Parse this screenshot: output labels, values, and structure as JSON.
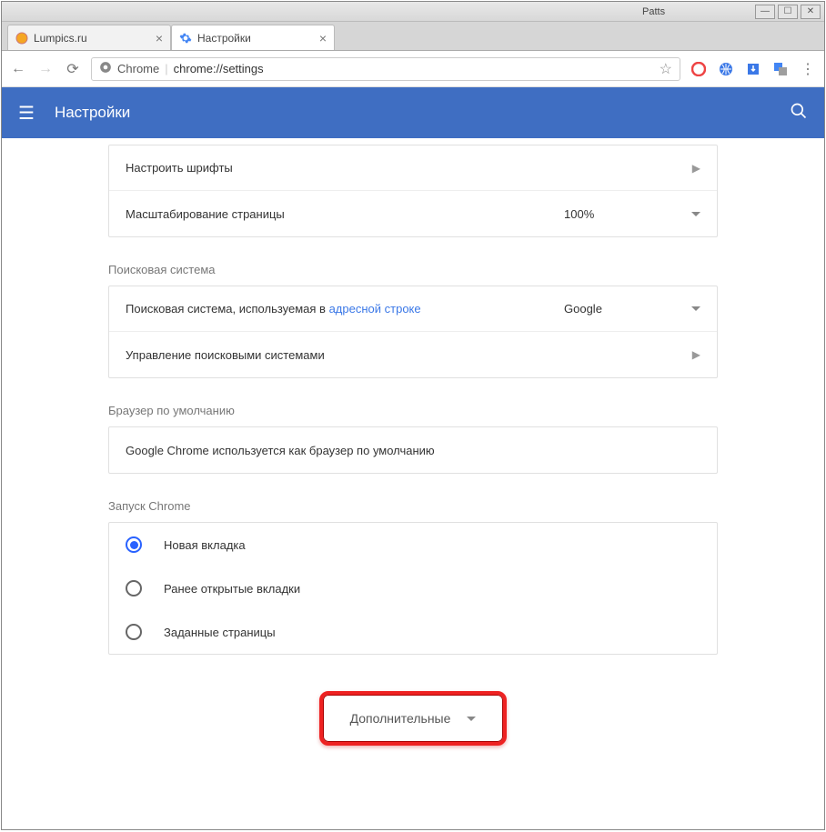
{
  "window": {
    "app_label": "Patts"
  },
  "tabs": [
    {
      "label": "Lumpics.ru",
      "favicon": "orange-circle"
    },
    {
      "label": "Настройки",
      "favicon": "gear-blue",
      "active": true
    }
  ],
  "omnibox": {
    "origin": "Chrome",
    "url": "chrome://settings"
  },
  "header": {
    "title": "Настройки"
  },
  "appearance": {
    "fonts_label": "Настроить шрифты",
    "zoom_label": "Масштабирование страницы",
    "zoom_value": "100%"
  },
  "search_engine": {
    "section": "Поисковая система",
    "used_in_prefix": "Поисковая система, используемая в ",
    "used_in_link": "адресной строке",
    "value": "Google",
    "manage_label": "Управление поисковыми системами"
  },
  "default_browser": {
    "section": "Браузер по умолчанию",
    "status": "Google Chrome используется как браузер по умолчанию"
  },
  "startup": {
    "section": "Запуск Chrome",
    "options": [
      "Новая вкладка",
      "Ранее открытые вкладки",
      "Заданные страницы"
    ],
    "selected": 0
  },
  "advanced_label": "Дополнительные"
}
